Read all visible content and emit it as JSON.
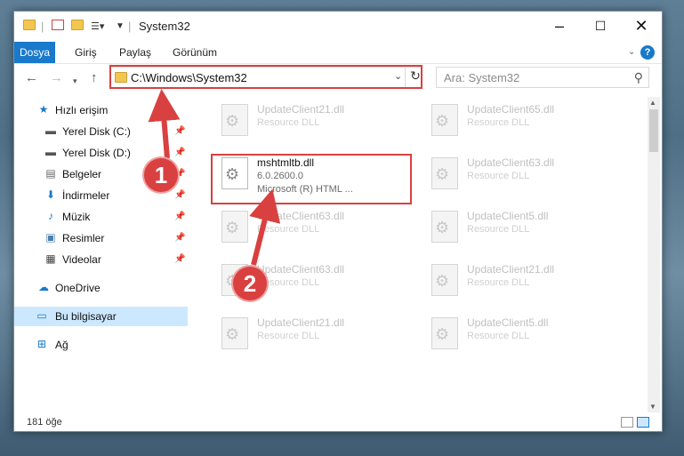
{
  "window": {
    "title": "System32"
  },
  "ribbon": {
    "tabs": [
      "Dosya",
      "Giriş",
      "Paylaş",
      "Görünüm"
    ]
  },
  "address": {
    "path": "C:\\Windows\\System32"
  },
  "search": {
    "placeholder": "Ara: System32"
  },
  "sidebar": {
    "quick_access": "Hızlı erişim",
    "items": [
      "Yerel Disk (C:)",
      "Yerel Disk (D:)",
      "Belgeler",
      "İndirmeler",
      "Müzik",
      "Resimler",
      "Videolar"
    ],
    "onedrive": "OneDrive",
    "this_pc": "Bu bilgisayar",
    "network": "Ağ"
  },
  "files": {
    "main": {
      "name": "mshtmltb.dll",
      "version": "6.0.2600.0",
      "desc": "Microsoft (R) HTML ..."
    },
    "faded": [
      {
        "name": "UpdateClient21.dll",
        "desc": "Resource DLL"
      },
      {
        "name": "UpdateClient65.dll",
        "desc": "Resource DLL"
      },
      {
        "name": "UpdateClient63.dll",
        "desc": "Resource DLL"
      },
      {
        "name": "UpdateClient63.dll",
        "desc": "Resource DLL"
      },
      {
        "name": "UpdateClient5.dll",
        "desc": "Resource DLL"
      },
      {
        "name": "UpdateClient63.dll",
        "desc": "Resource DLL"
      },
      {
        "name": "UpdateClient21.dll",
        "desc": "Resource DLL"
      },
      {
        "name": "UpdateClient21.dll",
        "desc": "Resource DLL"
      },
      {
        "name": "UpdateClient5.dll",
        "desc": "Resource DLL"
      }
    ]
  },
  "status": {
    "count": "181 öğe"
  },
  "annotations": {
    "step1": "1",
    "step2": "2"
  },
  "colors": {
    "accent": "#1979ca",
    "highlight": "#d94040",
    "selected": "#cce8ff"
  }
}
